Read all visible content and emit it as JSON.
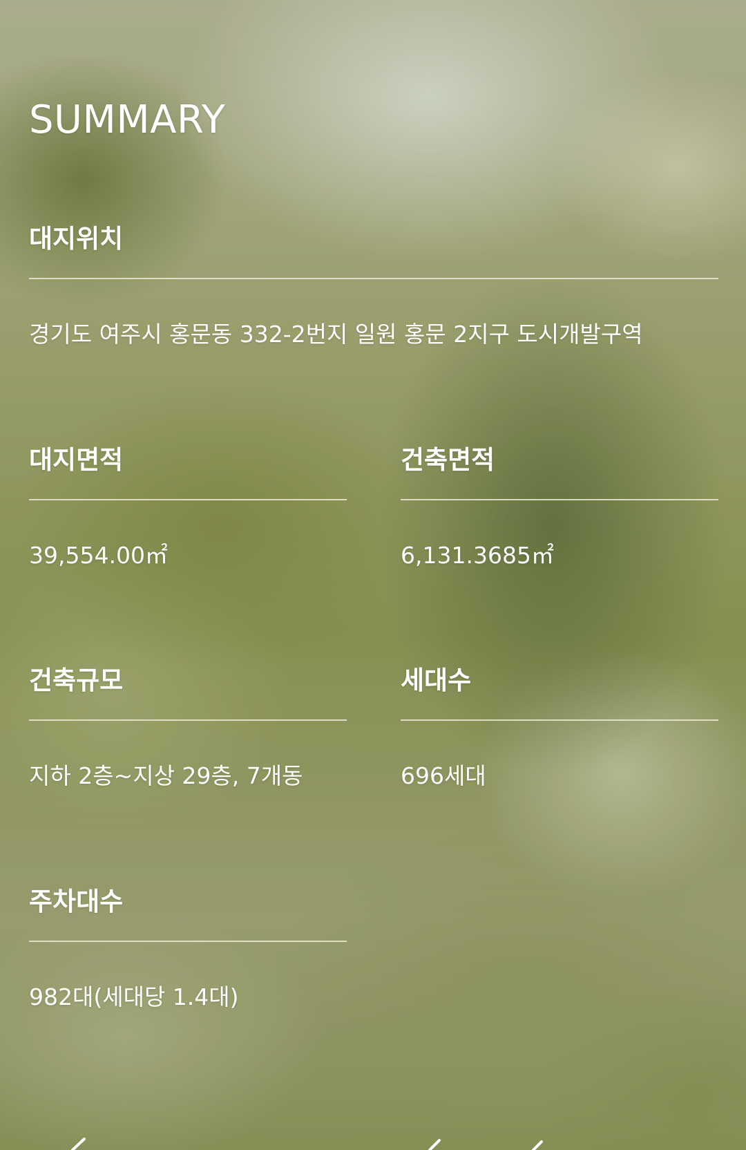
{
  "summary": {
    "title": "SUMMARY",
    "location": {
      "label": "대지위치",
      "value": "경기도 여주시 홍문동 332-2번지 일원 홍문 2지구 도시개발구역"
    },
    "site_area": {
      "label": "대지면적",
      "value": "39,554.00㎡"
    },
    "building_area": {
      "label": "건축면적",
      "value": "6,131.3685㎡"
    },
    "scale": {
      "label": "건축규모",
      "value": "지하 2층~지상 29층, 7개동"
    },
    "households": {
      "label": "세대수",
      "value": "696세대"
    },
    "parking": {
      "label": "주차대수",
      "value": "982대(세대당 1.4대)"
    }
  },
  "colors": {
    "text": "#ffffff",
    "rule": "#ecead6",
    "background_tone": "#a4a874"
  }
}
